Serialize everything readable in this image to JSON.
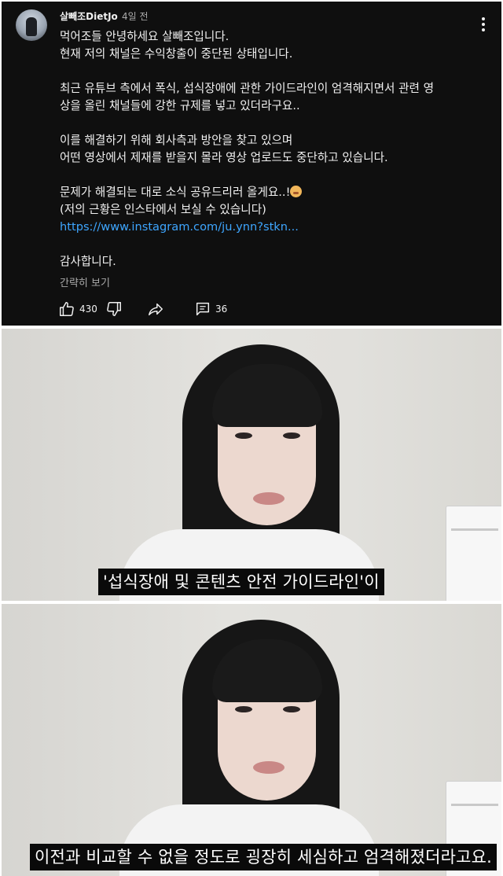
{
  "post": {
    "author": "살빼조DietJo",
    "time": "4일 전",
    "lines": [
      "먹어조들 안녕하세요 살빼조입니다.",
      "현재 저의 채널은 수익창출이 중단된 상태입니다.",
      "",
      "최근 유튜브 측에서 폭식, 섭식장애에 관한 가이드라인이 엄격해지면서 관련 영",
      "상을 올린 채널들에 강한 규제를 넣고 있더라구요..",
      "",
      "이를 해결하기 위해 회사측과 방안을 찾고 있으며",
      "어떤 영상에서 제재를 받을지 몰라 영상 업로드도 중단하고 있습니다.",
      "",
      "문제가 해결되는 대로 소식 공유드리러 올게요..!",
      "(저의 근황은 인스타에서 보실 수 있습니다)"
    ],
    "link": "https://www.instagram.com/ju.ynn?stkn...",
    "closing": "감사합니다.",
    "show_less": "간략히 보기",
    "likes": "430",
    "comments": "36"
  },
  "frames": [
    {
      "caption": "'섭식장애 및 콘텐츠 안전 가이드라인'이"
    },
    {
      "caption": "이전과 비교할 수 없을 정도로 굉장히 세심하고 엄격해졌더라고요."
    }
  ],
  "colors": {
    "post_bg": "#0f0f0f",
    "text": "#f1f1f1",
    "muted": "#aaaaaa",
    "link": "#3ea6ff",
    "caption_bg": "#0a0a0a"
  }
}
